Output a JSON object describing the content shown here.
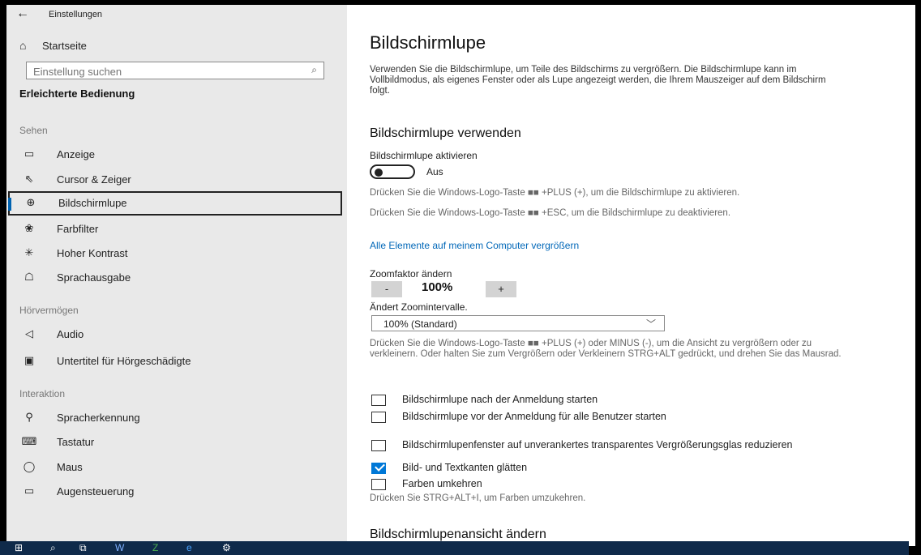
{
  "window": {
    "title": "Einstellungen",
    "back_glyph": "←"
  },
  "sidebar": {
    "home_label": "Startseite",
    "search_placeholder": "Einstellung suchen",
    "category": "Erleichterte Bedienung",
    "groups": [
      {
        "label": "Sehen"
      },
      {
        "label": "Hörvermögen"
      },
      {
        "label": "Interaktion"
      }
    ],
    "items": [
      {
        "label": "Anzeige",
        "icon": "monitor-icon"
      },
      {
        "label": "Cursor & Zeiger",
        "icon": "cursor-icon"
      },
      {
        "label": "Bildschirmlupe",
        "icon": "magnifier-icon",
        "selected": true
      },
      {
        "label": "Farbfilter",
        "icon": "palette-icon"
      },
      {
        "label": "Hoher Kontrast",
        "icon": "contrast-sun-icon"
      },
      {
        "label": "Sprachausgabe",
        "icon": "narrator-icon"
      },
      {
        "label": "Audio",
        "icon": "speaker-icon"
      },
      {
        "label": "Untertitel für Hörgeschädigte",
        "icon": "captions-icon"
      },
      {
        "label": "Spracherkennung",
        "icon": "microphone-icon"
      },
      {
        "label": "Tastatur",
        "icon": "keyboard-icon"
      },
      {
        "label": "Maus",
        "icon": "mouse-icon"
      },
      {
        "label": "Augensteuerung",
        "icon": "eye-control-icon"
      }
    ]
  },
  "main": {
    "title": "Bildschirmlupe",
    "intro": "Verwenden Sie die Bildschirmlupe, um Teile des Bildschirms zu vergrößern. Die Bildschirmlupe kann im Vollbildmodus, als eigenes Fenster oder als Lupe angezeigt werden, die Ihrem Mauszeiger auf dem Bildschirm folgt.",
    "section1": "Bildschirmlupe verwenden",
    "activate_label": "Bildschirmlupe aktivieren",
    "toggle_state": "Aus",
    "shortcut_hint_1": "Drücken Sie die Windows-Logo-Taste ■■ +PLUS (+), um die Bildschirmlupe zu aktivieren.",
    "shortcut_hint_2": "Drücken Sie die Windows-Logo-Taste ■■ +ESC, um die Bildschirmlupe zu deaktivieren.",
    "link_label": "Alle Elemente auf meinem Computer vergrößern",
    "zoom_label": "Zoomfaktor ändern",
    "zoom_minus": "-",
    "zoom_value": "100%",
    "zoom_plus": "+",
    "interval_label": "Ändert Zoomintervalle.",
    "interval_value": "100% (Standard)",
    "zoom_hint": "Drücken Sie die Windows-Logo-Taste ■■ +PLUS (+) oder MINUS (-), um die Ansicht zu vergrößern oder zu verkleinern. Oder halten Sie zum Vergrößern oder Verkleinern STRG+ALT gedrückt, und drehen Sie das Mausrad.",
    "checkboxes": [
      {
        "label": "Bildschirmlupe nach der Anmeldung starten",
        "checked": false
      },
      {
        "label": "Bildschirmlupe vor der Anmeldung für alle Benutzer starten",
        "checked": false
      },
      {
        "label": "Bildschirmlupenfenster auf unverankertes transparentes Vergrößerungsglas reduzieren",
        "checked": false
      },
      {
        "label": "Bild- und Textkanten glätten",
        "checked": true
      },
      {
        "label": "Farben umkehren",
        "checked": false
      }
    ],
    "invert_hint": "Drücken Sie STRG+ALT+I, um Farben umzukehren.",
    "section2": "Bildschirmlupenansicht ändern"
  },
  "taskbar": {
    "items": [
      "start-icon",
      "search-icon",
      "task-view-icon",
      "word-icon",
      "excel-icon",
      "edge-icon",
      "settings-gear-icon"
    ]
  },
  "colors": {
    "accent": "#0078d7",
    "sidebar_bg": "#e9e9e9",
    "taskbar_bg": "#0f2a4a"
  }
}
